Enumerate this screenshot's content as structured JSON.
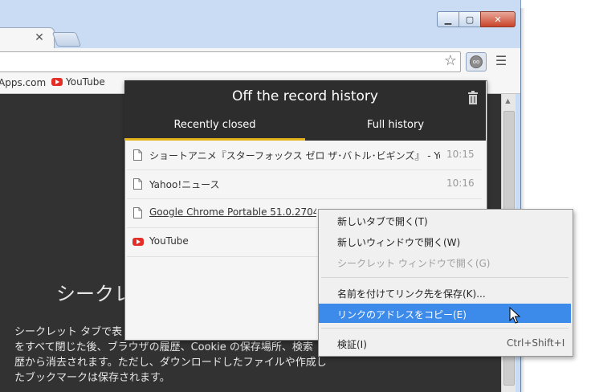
{
  "browser": {
    "bookmarks": [
      {
        "label": "Apps.com"
      },
      {
        "label": "YouTube"
      }
    ]
  },
  "incognito": {
    "title": "シークレ",
    "body_lines": [
      "シークレット タブで表",
      "をすべて閉じた後、ブラウザの履歴、Cookie の保存場所、検索",
      "歴から消去されます。ただし、ダウンロードしたファイルや作成し",
      "たブックマークは保存されます。"
    ]
  },
  "popup": {
    "title": "Off the record history",
    "tabs": [
      {
        "label": "Recently closed",
        "active": true
      },
      {
        "label": "Full history",
        "active": false
      }
    ],
    "items": [
      {
        "title": "ショートアニメ『スターフォックス ゼロ ザ･バトル･ビギンズ』 - You...",
        "time": "10:15",
        "icon": "page-icon"
      },
      {
        "title": "Yahoo!ニュース",
        "time": "10:16",
        "icon": "page-icon"
      },
      {
        "title": "Google Chrome Portable 51.0.2704",
        "time": "",
        "icon": "page-icon"
      },
      {
        "title": "YouTube",
        "time": "",
        "icon": "youtube-icon"
      }
    ]
  },
  "context_menu": {
    "items": [
      {
        "label": "新しいタブで開く(T)",
        "disabled": false
      },
      {
        "label": "新しいウィンドウで開く(W)",
        "disabled": false
      },
      {
        "label": "シークレット ウィンドウで開く(G)",
        "disabled": true
      },
      {
        "label": "名前を付けてリンク先を保存(K)...",
        "disabled": false
      },
      {
        "label": "リンクのアドレスをコピー(E)",
        "disabled": false,
        "highlighted": true
      },
      {
        "label": "検証(I)",
        "shortcut": "Ctrl+Shift+I",
        "disabled": false
      }
    ]
  },
  "colors": {
    "popup_header": "#2d2d2d",
    "tab_indicator": "#e4b31b",
    "menu_highlight": "#3c8ae9",
    "incognito_bg": "#323232"
  }
}
